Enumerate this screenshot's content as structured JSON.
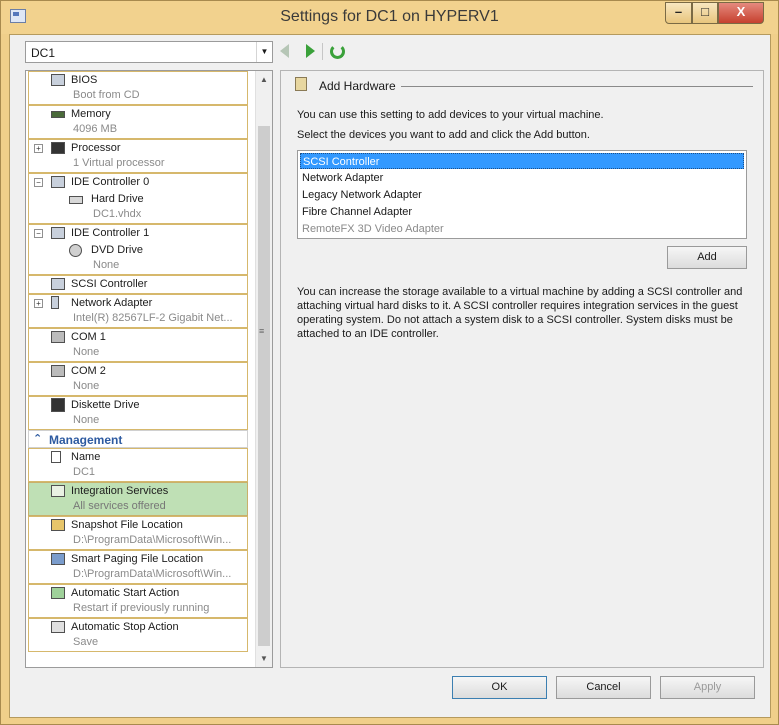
{
  "window": {
    "title": "Settings for DC1 on HYPERV1",
    "controls": {
      "minimize": "–",
      "maximize": "□",
      "close": "X"
    }
  },
  "vm_selector": {
    "value": "DC1"
  },
  "hardware_list": {
    "items": [
      {
        "label": "BIOS",
        "sub": "Boot from CD",
        "icon": "bios-icon"
      },
      {
        "label": "Memory",
        "sub": "4096 MB",
        "icon": "memory-icon"
      },
      {
        "label": "Processor",
        "sub": "1 Virtual processor",
        "icon": "processor-icon"
      },
      {
        "label": "IDE Controller 0",
        "icon": "ide-controller-icon"
      },
      {
        "label": "Hard Drive",
        "sub": "DC1.vhdx",
        "icon": "hard-drive-icon"
      },
      {
        "label": "IDE Controller 1",
        "icon": "ide-controller-icon"
      },
      {
        "label": "DVD Drive",
        "sub": "None",
        "icon": "dvd-drive-icon"
      },
      {
        "label": "SCSI Controller",
        "icon": "scsi-controller-icon"
      },
      {
        "label": "Network Adapter",
        "sub": "Intel(R) 82567LF-2 Gigabit Net...",
        "icon": "network-adapter-icon"
      },
      {
        "label": "COM 1",
        "sub": "None",
        "icon": "com-port-icon"
      },
      {
        "label": "COM 2",
        "sub": "None",
        "icon": "com-port-icon"
      },
      {
        "label": "Diskette Drive",
        "sub": "None",
        "icon": "diskette-icon"
      }
    ],
    "management_header": "Management",
    "management": [
      {
        "label": "Name",
        "sub": "DC1",
        "icon": "name-icon"
      },
      {
        "label": "Integration Services",
        "sub": "All services offered",
        "icon": "integration-services-icon"
      },
      {
        "label": "Snapshot File Location",
        "sub": "D:\\ProgramData\\Microsoft\\Win...",
        "icon": "snapshot-icon"
      },
      {
        "label": "Smart Paging File Location",
        "sub": "D:\\ProgramData\\Microsoft\\Win...",
        "icon": "smart-paging-icon"
      },
      {
        "label": "Automatic Start Action",
        "sub": "Restart if previously running",
        "icon": "start-action-icon"
      },
      {
        "label": "Automatic Stop Action",
        "sub": "Save",
        "icon": "stop-action-icon"
      }
    ]
  },
  "add_hardware": {
    "title": "Add Hardware",
    "intro": "You can use this setting to add devices to your virtual machine.",
    "instruction": "Select the devices you want to add and click the Add button.",
    "devices": [
      {
        "label": "SCSI Controller",
        "state": "selected"
      },
      {
        "label": "Network Adapter",
        "state": "normal"
      },
      {
        "label": "Legacy Network Adapter",
        "state": "normal"
      },
      {
        "label": "Fibre Channel Adapter",
        "state": "normal"
      },
      {
        "label": "RemoteFX 3D Video Adapter",
        "state": "disabled"
      }
    ],
    "add_label": "Add",
    "description": "You can increase the storage available to a virtual machine by adding a SCSI controller and attaching virtual hard disks to it. A SCSI controller requires integration services in the guest operating system. Do not attach a system disk to a SCSI controller. System disks must be attached to an IDE controller."
  },
  "footer": {
    "ok": "OK",
    "cancel": "Cancel",
    "apply": "Apply"
  },
  "colors": {
    "title_bar": "#f2d28e",
    "selection": "#3399ff",
    "selected_item": "#bfe0b5",
    "management_header": "#2d5aa0"
  }
}
